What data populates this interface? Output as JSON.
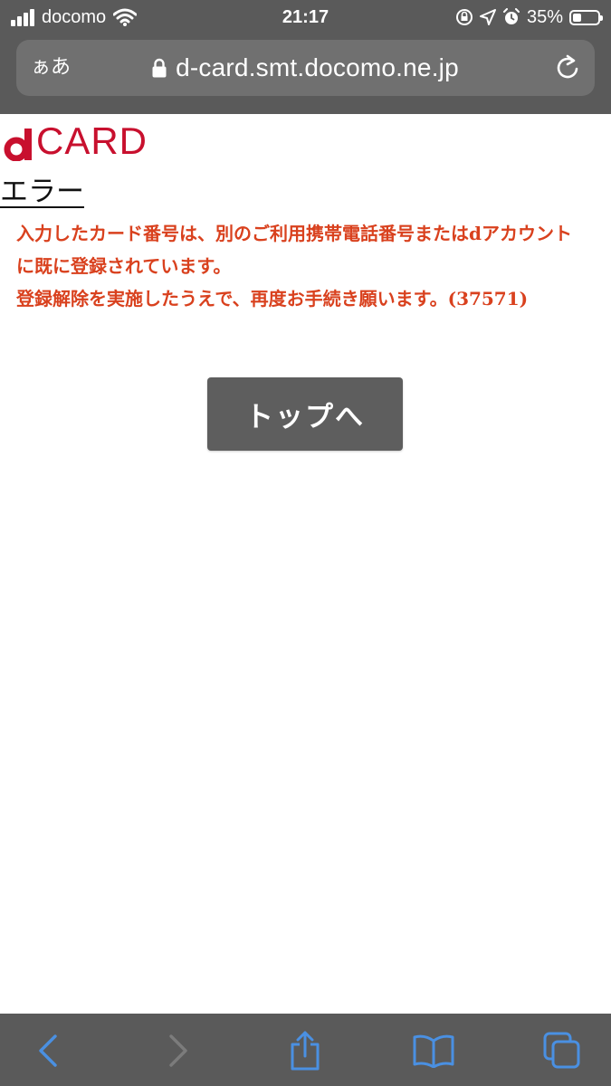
{
  "status_bar": {
    "carrier": "docomo",
    "time": "21:17",
    "battery_percent": "35%",
    "battery_level": 0.35,
    "icons": [
      "signal-icon",
      "wifi-icon",
      "orientation-lock-icon",
      "location-icon",
      "alarm-icon",
      "battery-icon"
    ]
  },
  "address_bar": {
    "text_size_label": "ぁあ",
    "url": "d-card.smt.docomo.ne.jp",
    "icons": [
      "lock-icon",
      "reload-icon"
    ]
  },
  "page": {
    "logo_letter": "d",
    "logo_text": "CARD",
    "logo_color": "#c8102e",
    "title": "エラー",
    "message_lines": [
      "入力したカード番号は、別のご利用携帯電話番号またはdアカウントに既に登録されています。",
      "登録解除を実施したうえで、再度お手続き願います。(37571)"
    ],
    "message_color": "#d9411e",
    "top_button_label": "トップへ"
  },
  "toolbar": {
    "accent": "#4a90e2",
    "icons": [
      "back-icon",
      "forward-icon",
      "share-icon",
      "bookmarks-icon",
      "tabs-icon"
    ]
  }
}
